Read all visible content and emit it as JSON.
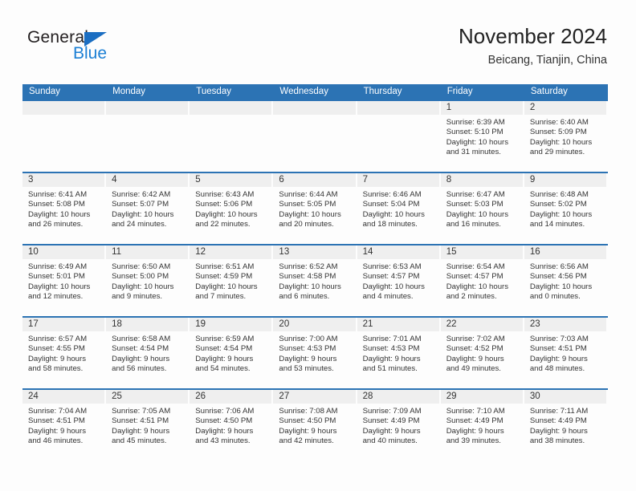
{
  "brand": {
    "name_top": "General",
    "name_bottom": "Blue",
    "triangle_color": "#1b6ec2",
    "blue_color": "#1b7fd4"
  },
  "header": {
    "title": "November 2024",
    "subtitle": "Beicang, Tianjin, China"
  },
  "theme": {
    "accent": "#2c73b4",
    "daynum_bg": "#efefef",
    "text": "#333333"
  },
  "weekdays": [
    "Sunday",
    "Monday",
    "Tuesday",
    "Wednesday",
    "Thursday",
    "Friday",
    "Saturday"
  ],
  "weeks": [
    [
      {
        "day": "",
        "sunrise": "",
        "sunset": "",
        "daylight1": "",
        "daylight2": ""
      },
      {
        "day": "",
        "sunrise": "",
        "sunset": "",
        "daylight1": "",
        "daylight2": ""
      },
      {
        "day": "",
        "sunrise": "",
        "sunset": "",
        "daylight1": "",
        "daylight2": ""
      },
      {
        "day": "",
        "sunrise": "",
        "sunset": "",
        "daylight1": "",
        "daylight2": ""
      },
      {
        "day": "",
        "sunrise": "",
        "sunset": "",
        "daylight1": "",
        "daylight2": ""
      },
      {
        "day": "1",
        "sunrise": "Sunrise: 6:39 AM",
        "sunset": "Sunset: 5:10 PM",
        "daylight1": "Daylight: 10 hours",
        "daylight2": "and 31 minutes."
      },
      {
        "day": "2",
        "sunrise": "Sunrise: 6:40 AM",
        "sunset": "Sunset: 5:09 PM",
        "daylight1": "Daylight: 10 hours",
        "daylight2": "and 29 minutes."
      }
    ],
    [
      {
        "day": "3",
        "sunrise": "Sunrise: 6:41 AM",
        "sunset": "Sunset: 5:08 PM",
        "daylight1": "Daylight: 10 hours",
        "daylight2": "and 26 minutes."
      },
      {
        "day": "4",
        "sunrise": "Sunrise: 6:42 AM",
        "sunset": "Sunset: 5:07 PM",
        "daylight1": "Daylight: 10 hours",
        "daylight2": "and 24 minutes."
      },
      {
        "day": "5",
        "sunrise": "Sunrise: 6:43 AM",
        "sunset": "Sunset: 5:06 PM",
        "daylight1": "Daylight: 10 hours",
        "daylight2": "and 22 minutes."
      },
      {
        "day": "6",
        "sunrise": "Sunrise: 6:44 AM",
        "sunset": "Sunset: 5:05 PM",
        "daylight1": "Daylight: 10 hours",
        "daylight2": "and 20 minutes."
      },
      {
        "day": "7",
        "sunrise": "Sunrise: 6:46 AM",
        "sunset": "Sunset: 5:04 PM",
        "daylight1": "Daylight: 10 hours",
        "daylight2": "and 18 minutes."
      },
      {
        "day": "8",
        "sunrise": "Sunrise: 6:47 AM",
        "sunset": "Sunset: 5:03 PM",
        "daylight1": "Daylight: 10 hours",
        "daylight2": "and 16 minutes."
      },
      {
        "day": "9",
        "sunrise": "Sunrise: 6:48 AM",
        "sunset": "Sunset: 5:02 PM",
        "daylight1": "Daylight: 10 hours",
        "daylight2": "and 14 minutes."
      }
    ],
    [
      {
        "day": "10",
        "sunrise": "Sunrise: 6:49 AM",
        "sunset": "Sunset: 5:01 PM",
        "daylight1": "Daylight: 10 hours",
        "daylight2": "and 12 minutes."
      },
      {
        "day": "11",
        "sunrise": "Sunrise: 6:50 AM",
        "sunset": "Sunset: 5:00 PM",
        "daylight1": "Daylight: 10 hours",
        "daylight2": "and 9 minutes."
      },
      {
        "day": "12",
        "sunrise": "Sunrise: 6:51 AM",
        "sunset": "Sunset: 4:59 PM",
        "daylight1": "Daylight: 10 hours",
        "daylight2": "and 7 minutes."
      },
      {
        "day": "13",
        "sunrise": "Sunrise: 6:52 AM",
        "sunset": "Sunset: 4:58 PM",
        "daylight1": "Daylight: 10 hours",
        "daylight2": "and 6 minutes."
      },
      {
        "day": "14",
        "sunrise": "Sunrise: 6:53 AM",
        "sunset": "Sunset: 4:57 PM",
        "daylight1": "Daylight: 10 hours",
        "daylight2": "and 4 minutes."
      },
      {
        "day": "15",
        "sunrise": "Sunrise: 6:54 AM",
        "sunset": "Sunset: 4:57 PM",
        "daylight1": "Daylight: 10 hours",
        "daylight2": "and 2 minutes."
      },
      {
        "day": "16",
        "sunrise": "Sunrise: 6:56 AM",
        "sunset": "Sunset: 4:56 PM",
        "daylight1": "Daylight: 10 hours",
        "daylight2": "and 0 minutes."
      }
    ],
    [
      {
        "day": "17",
        "sunrise": "Sunrise: 6:57 AM",
        "sunset": "Sunset: 4:55 PM",
        "daylight1": "Daylight: 9 hours",
        "daylight2": "and 58 minutes."
      },
      {
        "day": "18",
        "sunrise": "Sunrise: 6:58 AM",
        "sunset": "Sunset: 4:54 PM",
        "daylight1": "Daylight: 9 hours",
        "daylight2": "and 56 minutes."
      },
      {
        "day": "19",
        "sunrise": "Sunrise: 6:59 AM",
        "sunset": "Sunset: 4:54 PM",
        "daylight1": "Daylight: 9 hours",
        "daylight2": "and 54 minutes."
      },
      {
        "day": "20",
        "sunrise": "Sunrise: 7:00 AM",
        "sunset": "Sunset: 4:53 PM",
        "daylight1": "Daylight: 9 hours",
        "daylight2": "and 53 minutes."
      },
      {
        "day": "21",
        "sunrise": "Sunrise: 7:01 AM",
        "sunset": "Sunset: 4:53 PM",
        "daylight1": "Daylight: 9 hours",
        "daylight2": "and 51 minutes."
      },
      {
        "day": "22",
        "sunrise": "Sunrise: 7:02 AM",
        "sunset": "Sunset: 4:52 PM",
        "daylight1": "Daylight: 9 hours",
        "daylight2": "and 49 minutes."
      },
      {
        "day": "23",
        "sunrise": "Sunrise: 7:03 AM",
        "sunset": "Sunset: 4:51 PM",
        "daylight1": "Daylight: 9 hours",
        "daylight2": "and 48 minutes."
      }
    ],
    [
      {
        "day": "24",
        "sunrise": "Sunrise: 7:04 AM",
        "sunset": "Sunset: 4:51 PM",
        "daylight1": "Daylight: 9 hours",
        "daylight2": "and 46 minutes."
      },
      {
        "day": "25",
        "sunrise": "Sunrise: 7:05 AM",
        "sunset": "Sunset: 4:51 PM",
        "daylight1": "Daylight: 9 hours",
        "daylight2": "and 45 minutes."
      },
      {
        "day": "26",
        "sunrise": "Sunrise: 7:06 AM",
        "sunset": "Sunset: 4:50 PM",
        "daylight1": "Daylight: 9 hours",
        "daylight2": "and 43 minutes."
      },
      {
        "day": "27",
        "sunrise": "Sunrise: 7:08 AM",
        "sunset": "Sunset: 4:50 PM",
        "daylight1": "Daylight: 9 hours",
        "daylight2": "and 42 minutes."
      },
      {
        "day": "28",
        "sunrise": "Sunrise: 7:09 AM",
        "sunset": "Sunset: 4:49 PM",
        "daylight1": "Daylight: 9 hours",
        "daylight2": "and 40 minutes."
      },
      {
        "day": "29",
        "sunrise": "Sunrise: 7:10 AM",
        "sunset": "Sunset: 4:49 PM",
        "daylight1": "Daylight: 9 hours",
        "daylight2": "and 39 minutes."
      },
      {
        "day": "30",
        "sunrise": "Sunrise: 7:11 AM",
        "sunset": "Sunset: 4:49 PM",
        "daylight1": "Daylight: 9 hours",
        "daylight2": "and 38 minutes."
      }
    ]
  ]
}
